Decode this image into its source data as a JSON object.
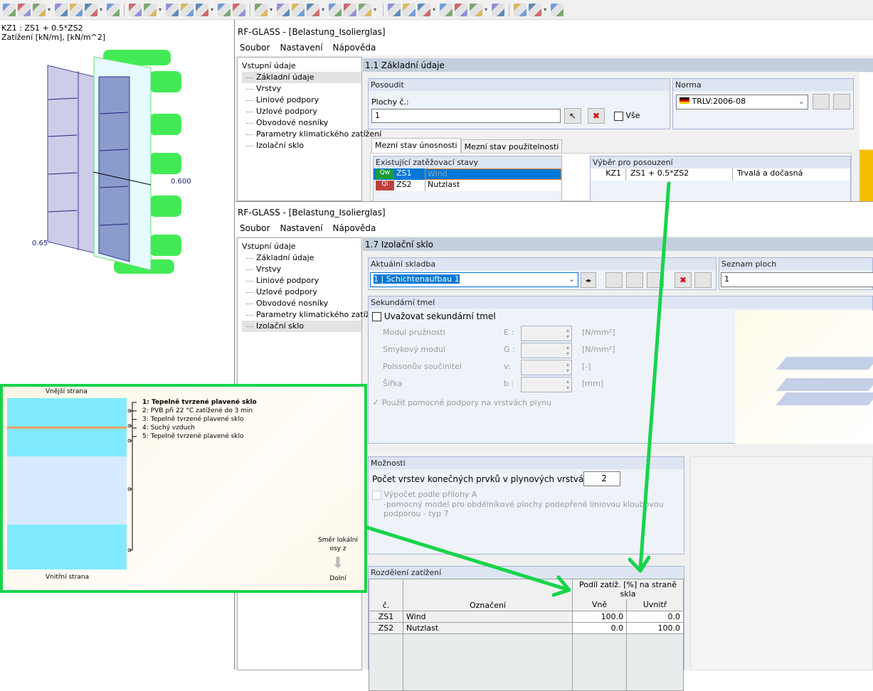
{
  "toolbar": {
    "icons": [
      "new-surface-icon",
      "rectangle-icon",
      "solid-icon",
      "box-icon",
      "copy-icon",
      "move-icon",
      "load-icon",
      "load-group-icon",
      "load-group2-icon",
      "generate-icon",
      "wizard-icon",
      "zoom-model-icon",
      "zoom-window-icon",
      "zoom-cancel-icon",
      "isometric-icon",
      "view-3d-icon",
      "view-x-icon",
      "view-y-icon",
      "view-z-icon",
      "view-minus-x-icon",
      "display-icon",
      "render-icon",
      "line-icon",
      "surface-icon",
      "solid-view-icon",
      "axis-icon",
      "node-icon",
      "grid-icon",
      "support-icon",
      "table-icon",
      "color-icon"
    ]
  },
  "viewport": {
    "line1": "KZ1 : ZS1 + 0.5*ZS2",
    "line2": "Zatížení [kN/m], [kN/m^2]",
    "label_a": "0.600",
    "label_b": "0.65"
  },
  "window1": {
    "title": "RF-GLASS - [Belastung_Isolierglas]",
    "menu": [
      "Soubor",
      "Nastavení",
      "Nápověda"
    ],
    "tree": {
      "root": "Vstupní údaje",
      "items": [
        "Základní údaje",
        "Vrstvy",
        "Liniové podpory",
        "Uzlové podpory",
        "Obvodové nosníky",
        "Parametry klimatického zatížení",
        "Izolační sklo"
      ]
    },
    "section": "1.1 Základní údaje",
    "posoudit": {
      "title": "Posoudit",
      "label": "Plochy č.:",
      "value": "1",
      "all_label": "Vše"
    },
    "norma": {
      "title": "Norma",
      "value": "TRLV:2006-08"
    },
    "tabs": [
      "Mezní stav únosnosti",
      "Mezní stav použitelnosti"
    ],
    "existing": {
      "title": "Existující zatěžovací stavy",
      "rows": [
        {
          "badge": "Qw",
          "badge_color": "#1a9c3a",
          "id": "ZS1",
          "name": "Wind"
        },
        {
          "badge": "Qi",
          "badge_color": "#c04040",
          "id": "ZS2",
          "name": "Nutzlast"
        }
      ]
    },
    "selection": {
      "title": "Výběr pro posouzení",
      "rows": [
        {
          "id": "KZ1",
          "formula": "ZS1 + 0.5*ZS2",
          "type": "Trvalá a dočasná"
        }
      ]
    }
  },
  "window2": {
    "title": "RF-GLASS - [Belastung_Isolierglas]",
    "menu": [
      "Soubor",
      "Nastavení",
      "Nápověda"
    ],
    "tree": {
      "root": "Vstupní údaje",
      "items": [
        "Základní údaje",
        "Vrstvy",
        "Liniové podpory",
        "Uzlové podpory",
        "Obvodové nosníky",
        "Parametry klimatického zatížení",
        "Izolační sklo"
      ]
    },
    "section": "1.7 Izolační sklo",
    "current": {
      "title": "Aktuální skladba",
      "value": "1 | Schichtenaufbau 1"
    },
    "surfaces": {
      "title": "Seznam ploch",
      "value": "1"
    },
    "sealant": {
      "title": "Sekundární tmel",
      "checkbox": "Uvažovat sekundární tmel",
      "fields": [
        {
          "label": "Modul pružnosti",
          "sym": "E :",
          "unit": "[N/mm²]"
        },
        {
          "label": "Smykový modul",
          "sym": "G :",
          "unit": "[N/mm²]"
        },
        {
          "label": "Poissonův součinitel",
          "sym": "v:",
          "unit": "[-]"
        },
        {
          "label": "Šířka",
          "sym": "b :",
          "unit": "[mm]"
        }
      ],
      "aux": "Použít pomocné podpory na vrstvách plynu"
    },
    "options": {
      "title": "Možnosti",
      "fe_label": "Počet vrstev konečných prvků v plynových vrstvách:",
      "fe_value": "2",
      "annex_line1": "Výpočet podle přílohy A",
      "annex_line2": "-pomocný model pro obdélníkové plochy podepřené liniovou kloubovou",
      "annex_line3": "podporou - typ 7"
    },
    "distribution": {
      "title": "Rozdělení zatížení",
      "h_no": "č.",
      "h_name": "Označení",
      "h_share": "Podíl zatíž. [%] na straně skla",
      "h_out": "Vně",
      "h_in": "Uvnitř",
      "rows": [
        {
          "no": "ZS1",
          "name": "Wind",
          "out": "100.0",
          "in": "0.0"
        },
        {
          "no": "ZS2",
          "name": "Nutzlast",
          "out": "0.0",
          "in": "100.0"
        }
      ]
    }
  },
  "layers": {
    "outer": "Vnější strana",
    "inner": "Vnitřní strana",
    "items": [
      "1: Tepelně tvrzené plavené sklo",
      "2: PVB při 22 °C zatížené do 3 min",
      "3: Tepelně tvrzené plavené sklo",
      "4: Suchý vzduch",
      "5: Tepelně tvrzené plavené sklo"
    ],
    "axis_line1": "Směr lokální",
    "axis_line2": "osy z",
    "axis_dir": "Dolní"
  },
  "colors": {
    "highlight": "#17d44a",
    "selection": "#0078d7",
    "glass": "#80eaff",
    "gas": "#d6eaff",
    "pvb": "#f5a060"
  }
}
